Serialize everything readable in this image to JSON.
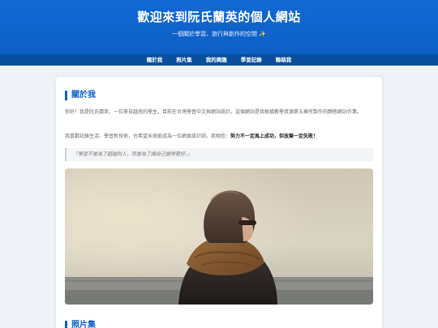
{
  "header": {
    "title": "歡迎來到阮氏蘭英的個人網站",
    "subtitle": "一個關於學習、旅行與創作的空間 ✨"
  },
  "nav": {
    "items": [
      {
        "label": "關於我"
      },
      {
        "label": "照片集"
      },
      {
        "label": "我的興趣"
      },
      {
        "label": "學習記錄"
      },
      {
        "label": "聯絡我"
      }
    ]
  },
  "about": {
    "title": "關於我",
    "para1": "你好！我是阮氏蘭英，一位來自越南的學生，目前在台灣學習中文與網站設計。這個網站是我根據教學資源第五章所製作的靜態網站作業。",
    "para2_prefix": "我喜歡記錄生活、學習新技術，也希望未來能成為一位網頁設計師。我相信：",
    "para2_strong": "努力不一定馬上成功，但放棄一定失敗！",
    "quote": "「學習不是為了超越別人，而是為了讓自己變得更好。」",
    "photo_label": "woman-with-scarf-photo"
  },
  "gallery": {
    "title": "照片集"
  },
  "colors": {
    "primary": "#0d5fc6",
    "nav_bg": "#0a4f9c",
    "page_bg": "#eef1f5"
  }
}
